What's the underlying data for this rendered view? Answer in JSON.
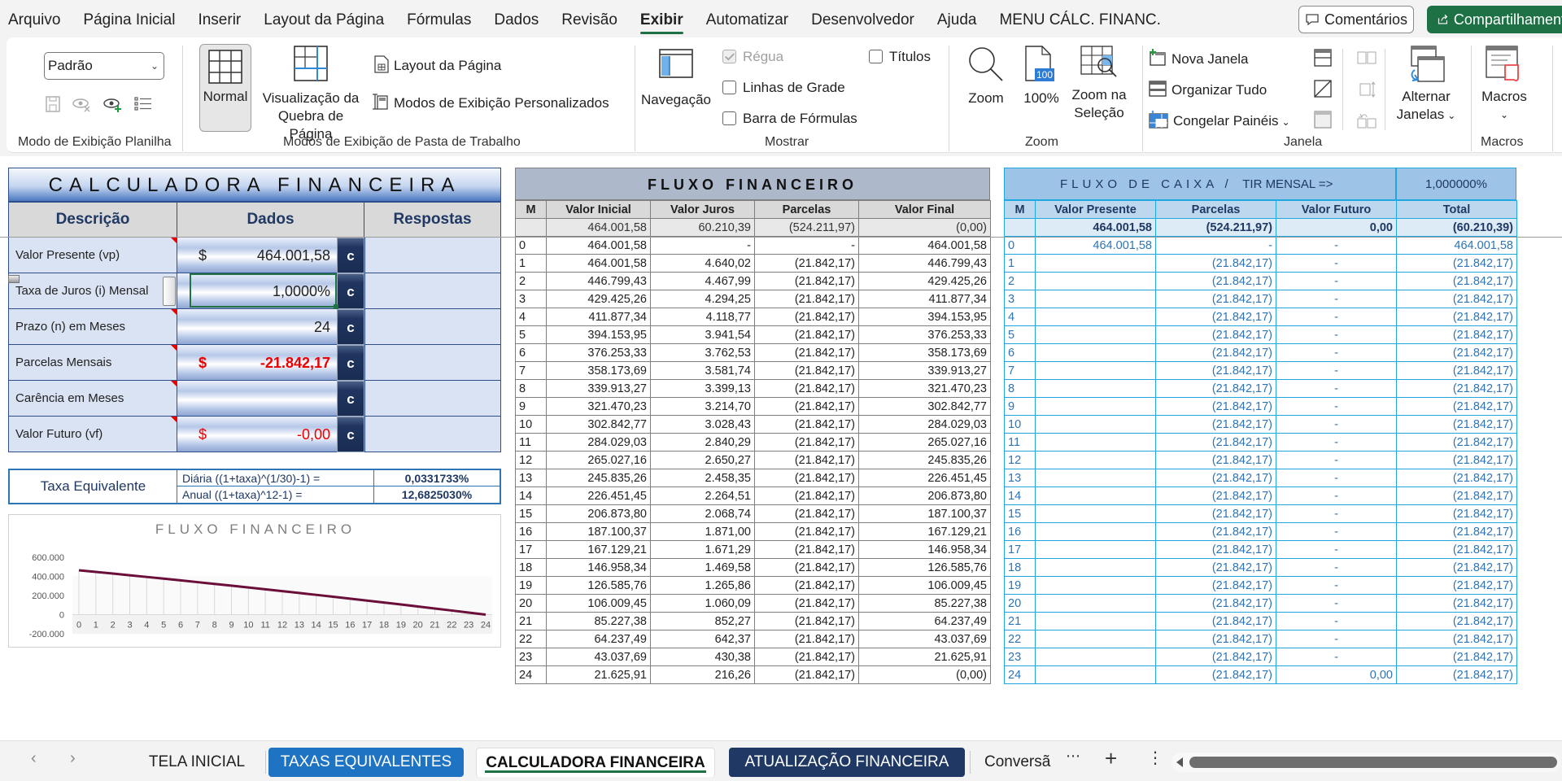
{
  "menu": {
    "items": [
      "Arquivo",
      "Página Inicial",
      "Inserir",
      "Layout da Página",
      "Fórmulas",
      "Dados",
      "Revisão",
      "Exibir",
      "Automatizar",
      "Desenvolvedor",
      "Ajuda",
      "MENU CÁLC. FINANC."
    ],
    "active": "Exibir",
    "comments_label": "Comentários",
    "share_label": "Compartilhamento"
  },
  "ribbon": {
    "sheet_view": {
      "style_select": "Padrão",
      "group_label": "Modo de Exibição Planilha"
    },
    "workbook_views": {
      "normal": "Normal",
      "page_break_line1": "Visualização da",
      "page_break_line2": "Quebra de Página",
      "page_layout": "Layout da Página",
      "custom_views": "Modos de Exibição Personalizados",
      "group_label": "Modos de Exibição de Pasta de Trabalho"
    },
    "show": {
      "navigation": "Navegação",
      "ruler": "Régua",
      "ruler_checked": true,
      "gridlines": "Linhas de Grade",
      "gridlines_checked": false,
      "formula_bar": "Barra de Fórmulas",
      "formula_bar_checked": false,
      "headings": "Títulos",
      "headings_checked": false,
      "group_label": "Mostrar"
    },
    "zoom": {
      "zoom": "Zoom",
      "hundred": "100%",
      "hundred_badge": "100",
      "zoom_sel_line1": "Zoom na",
      "zoom_sel_line2": "Seleção",
      "group_label": "Zoom"
    },
    "window": {
      "new_window": "Nova Janela",
      "arrange_all": "Organizar Tudo",
      "freeze_panes": "Congelar Painéis",
      "switch_line1": "Alternar",
      "switch_line2": "Janelas",
      "group_label": "Janela"
    },
    "macros": {
      "label": "Macros",
      "group_label": "Macros"
    }
  },
  "calculator": {
    "title": "CALCULADORA FINANCEIRA",
    "headers": {
      "desc": "Descrição",
      "data": "Dados",
      "answers": "Respostas"
    },
    "rows": [
      {
        "label": "Valor Presente (vp)",
        "currency": "$",
        "value": "464.001,58",
        "btn": "c"
      },
      {
        "label": "Taxa de Juros (i) Mensal",
        "currency": "",
        "value": "1,0000%",
        "btn": "c"
      },
      {
        "label": "Prazo (n) em Meses",
        "currency": "",
        "value": "24",
        "btn": "c"
      },
      {
        "label": "Parcelas Mensais",
        "currency": "$",
        "value": "-21.842,17",
        "btn": "c"
      },
      {
        "label": "Carência em Meses",
        "currency": "",
        "value": "",
        "btn": "c"
      },
      {
        "label": "Valor Futuro (vf)",
        "currency": "$",
        "value": "-0,00",
        "btn": "c"
      }
    ],
    "equiv": {
      "label": "Taxa Equivalente",
      "daily_formula": "Diária ((1+taxa)^(1/30)-1) =",
      "daily_value": "0,0331733%",
      "annual_formula": "Anual ((1+taxa)^12-1)     =",
      "annual_value": "12,6825030%"
    }
  },
  "fluxo_financeiro": {
    "title": "FLUXO  FINANCEIRO",
    "headers": [
      "M",
      "Valor Inicial",
      "Valor Juros",
      "Parcelas",
      "Valor Final"
    ],
    "totals": [
      "",
      "464.001,58",
      "60.210,39",
      "(524.211,97)",
      "(0,00)"
    ],
    "rows": [
      [
        "0",
        "464.001,58",
        "-",
        "-",
        "464.001,58"
      ],
      [
        "1",
        "464.001,58",
        "4.640,02",
        "(21.842,17)",
        "446.799,43"
      ],
      [
        "2",
        "446.799,43",
        "4.467,99",
        "(21.842,17)",
        "429.425,26"
      ],
      [
        "3",
        "429.425,26",
        "4.294,25",
        "(21.842,17)",
        "411.877,34"
      ],
      [
        "4",
        "411.877,34",
        "4.118,77",
        "(21.842,17)",
        "394.153,95"
      ],
      [
        "5",
        "394.153,95",
        "3.941,54",
        "(21.842,17)",
        "376.253,33"
      ],
      [
        "6",
        "376.253,33",
        "3.762,53",
        "(21.842,17)",
        "358.173,69"
      ],
      [
        "7",
        "358.173,69",
        "3.581,74",
        "(21.842,17)",
        "339.913,27"
      ],
      [
        "8",
        "339.913,27",
        "3.399,13",
        "(21.842,17)",
        "321.470,23"
      ],
      [
        "9",
        "321.470,23",
        "3.214,70",
        "(21.842,17)",
        "302.842,77"
      ],
      [
        "10",
        "302.842,77",
        "3.028,43",
        "(21.842,17)",
        "284.029,03"
      ],
      [
        "11",
        "284.029,03",
        "2.840,29",
        "(21.842,17)",
        "265.027,16"
      ],
      [
        "12",
        "265.027,16",
        "2.650,27",
        "(21.842,17)",
        "245.835,26"
      ],
      [
        "13",
        "245.835,26",
        "2.458,35",
        "(21.842,17)",
        "226.451,45"
      ],
      [
        "14",
        "226.451,45",
        "2.264,51",
        "(21.842,17)",
        "206.873,80"
      ],
      [
        "15",
        "206.873,80",
        "2.068,74",
        "(21.842,17)",
        "187.100,37"
      ],
      [
        "16",
        "187.100,37",
        "1.871,00",
        "(21.842,17)",
        "167.129,21"
      ],
      [
        "17",
        "167.129,21",
        "1.671,29",
        "(21.842,17)",
        "146.958,34"
      ],
      [
        "18",
        "146.958,34",
        "1.469,58",
        "(21.842,17)",
        "126.585,76"
      ],
      [
        "19",
        "126.585,76",
        "1.265,86",
        "(21.842,17)",
        "106.009,45"
      ],
      [
        "20",
        "106.009,45",
        "1.060,09",
        "(21.842,17)",
        "85.227,38"
      ],
      [
        "21",
        "85.227,38",
        "852,27",
        "(21.842,17)",
        "64.237,49"
      ],
      [
        "22",
        "64.237,49",
        "642,37",
        "(21.842,17)",
        "43.037,69"
      ],
      [
        "23",
        "43.037,69",
        "430,38",
        "(21.842,17)",
        "21.625,91"
      ],
      [
        "24",
        "21.625,91",
        "216,26",
        "(21.842,17)",
        "(0,00)"
      ]
    ]
  },
  "fluxo_caixa": {
    "title_spaced": "FLUXO DE CAIXA   /",
    "title_tir": "TIR MENSAL =>",
    "tir_value": "1,000000%",
    "headers": [
      "M",
      "Valor Presente",
      "Parcelas",
      "Valor Futuro",
      "Total"
    ],
    "totals": [
      "",
      "464.001,58",
      "(524.211,97)",
      "0,00",
      "(60.210,39)"
    ],
    "rows": [
      [
        "0",
        "464.001,58",
        "-",
        "-",
        "464.001,58"
      ],
      [
        "1",
        "",
        "(21.842,17)",
        "-",
        "(21.842,17)"
      ],
      [
        "2",
        "",
        "(21.842,17)",
        "-",
        "(21.842,17)"
      ],
      [
        "3",
        "",
        "(21.842,17)",
        "-",
        "(21.842,17)"
      ],
      [
        "4",
        "",
        "(21.842,17)",
        "-",
        "(21.842,17)"
      ],
      [
        "5",
        "",
        "(21.842,17)",
        "-",
        "(21.842,17)"
      ],
      [
        "6",
        "",
        "(21.842,17)",
        "-",
        "(21.842,17)"
      ],
      [
        "7",
        "",
        "(21.842,17)",
        "-",
        "(21.842,17)"
      ],
      [
        "8",
        "",
        "(21.842,17)",
        "-",
        "(21.842,17)"
      ],
      [
        "9",
        "",
        "(21.842,17)",
        "-",
        "(21.842,17)"
      ],
      [
        "10",
        "",
        "(21.842,17)",
        "-",
        "(21.842,17)"
      ],
      [
        "11",
        "",
        "(21.842,17)",
        "-",
        "(21.842,17)"
      ],
      [
        "12",
        "",
        "(21.842,17)",
        "-",
        "(21.842,17)"
      ],
      [
        "13",
        "",
        "(21.842,17)",
        "-",
        "(21.842,17)"
      ],
      [
        "14",
        "",
        "(21.842,17)",
        "-",
        "(21.842,17)"
      ],
      [
        "15",
        "",
        "(21.842,17)",
        "-",
        "(21.842,17)"
      ],
      [
        "16",
        "",
        "(21.842,17)",
        "-",
        "(21.842,17)"
      ],
      [
        "17",
        "",
        "(21.842,17)",
        "-",
        "(21.842,17)"
      ],
      [
        "18",
        "",
        "(21.842,17)",
        "-",
        "(21.842,17)"
      ],
      [
        "19",
        "",
        "(21.842,17)",
        "-",
        "(21.842,17)"
      ],
      [
        "20",
        "",
        "(21.842,17)",
        "-",
        "(21.842,17)"
      ],
      [
        "21",
        "",
        "(21.842,17)",
        "-",
        "(21.842,17)"
      ],
      [
        "22",
        "",
        "(21.842,17)",
        "-",
        "(21.842,17)"
      ],
      [
        "23",
        "",
        "(21.842,17)",
        "-",
        "(21.842,17)"
      ],
      [
        "24",
        "",
        "(21.842,17)",
        "0,00",
        "(21.842,17)"
      ]
    ]
  },
  "chart_data": {
    "type": "line",
    "title": "FLUXO  FINANCEIRO",
    "xlabel": "",
    "ylabel": "",
    "x": [
      0,
      1,
      2,
      3,
      4,
      5,
      6,
      7,
      8,
      9,
      10,
      11,
      12,
      13,
      14,
      15,
      16,
      17,
      18,
      19,
      20,
      21,
      22,
      23,
      24
    ],
    "series": [
      {
        "name": "Valor Final",
        "color": "#6b0f3a",
        "values": [
          464001.58,
          446799.43,
          429425.26,
          411877.34,
          394153.95,
          376253.33,
          358173.69,
          339913.27,
          321470.23,
          302842.77,
          284029.03,
          265027.16,
          245835.26,
          226451.45,
          206873.8,
          187100.37,
          167129.21,
          146958.34,
          126585.76,
          106009.45,
          85227.38,
          64237.49,
          43037.69,
          21625.91,
          0
        ]
      }
    ],
    "ylim": [
      -200000,
      600000
    ],
    "yticks": [
      "600.000",
      "400.000",
      "200.000",
      "0",
      "-200.000"
    ],
    "ytick_values": [
      600000,
      400000,
      200000,
      0,
      -200000
    ],
    "grid": "vertical",
    "legend": "none"
  },
  "tabs": {
    "items": [
      "TELA INICIAL",
      "TAXAS EQUIVALENTES",
      "CALCULADORA FINANCEIRA",
      "ATUALIZAÇÃO FINANCEIRA",
      "Conversã"
    ],
    "active": "CALCULADORA FINANCEIRA"
  },
  "colors": {
    "accent_green": "#1e7145",
    "tab_blue": "#1f73c3",
    "tab_navy": "#1f3864",
    "negative_red": "#ee0000",
    "cashflow_blue": "#1fa7e0"
  }
}
